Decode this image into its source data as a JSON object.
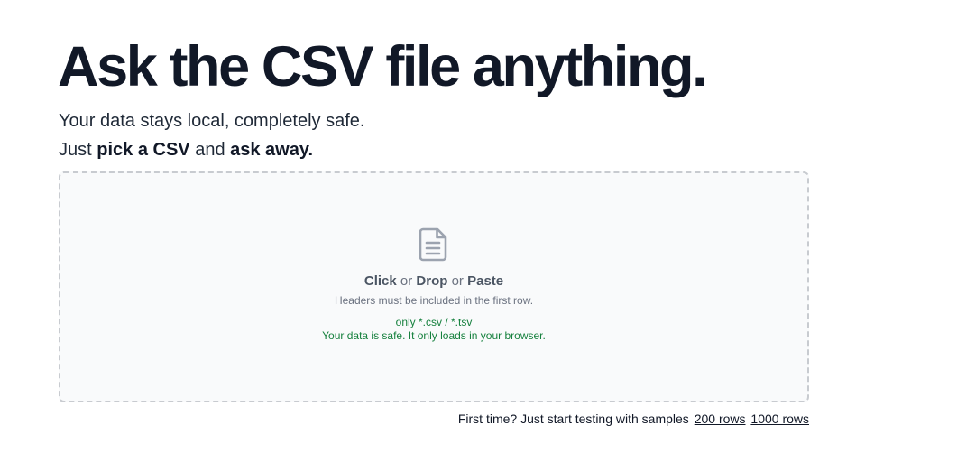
{
  "hero": {
    "title": "Ask the CSV file anything.",
    "subtitle": "Your data stays local, completely safe.",
    "line2": {
      "prefix": "Just ",
      "pick": "pick a CSV",
      "middle": " and ",
      "ask": "ask away."
    }
  },
  "dropzone": {
    "icon": "file-text-icon",
    "click": "Click",
    "or1": " or ",
    "drop": "Drop",
    "or2": " or ",
    "paste": "Paste",
    "hint": "Headers must be included in the first row.",
    "extensions": "only *.csv / *.tsv",
    "safety": "Your data is safe. It only loads in your browser."
  },
  "samples": {
    "prompt": "First time? Just start testing with samples",
    "link_200": "200 rows",
    "link_1000": "1000 rows"
  },
  "colors": {
    "heading": "#111827",
    "body": "#1f2937",
    "muted": "#6b7280",
    "success": "#15803d",
    "dropzone_bg": "#f9fafb",
    "dropzone_border": "#c8cbd0"
  }
}
